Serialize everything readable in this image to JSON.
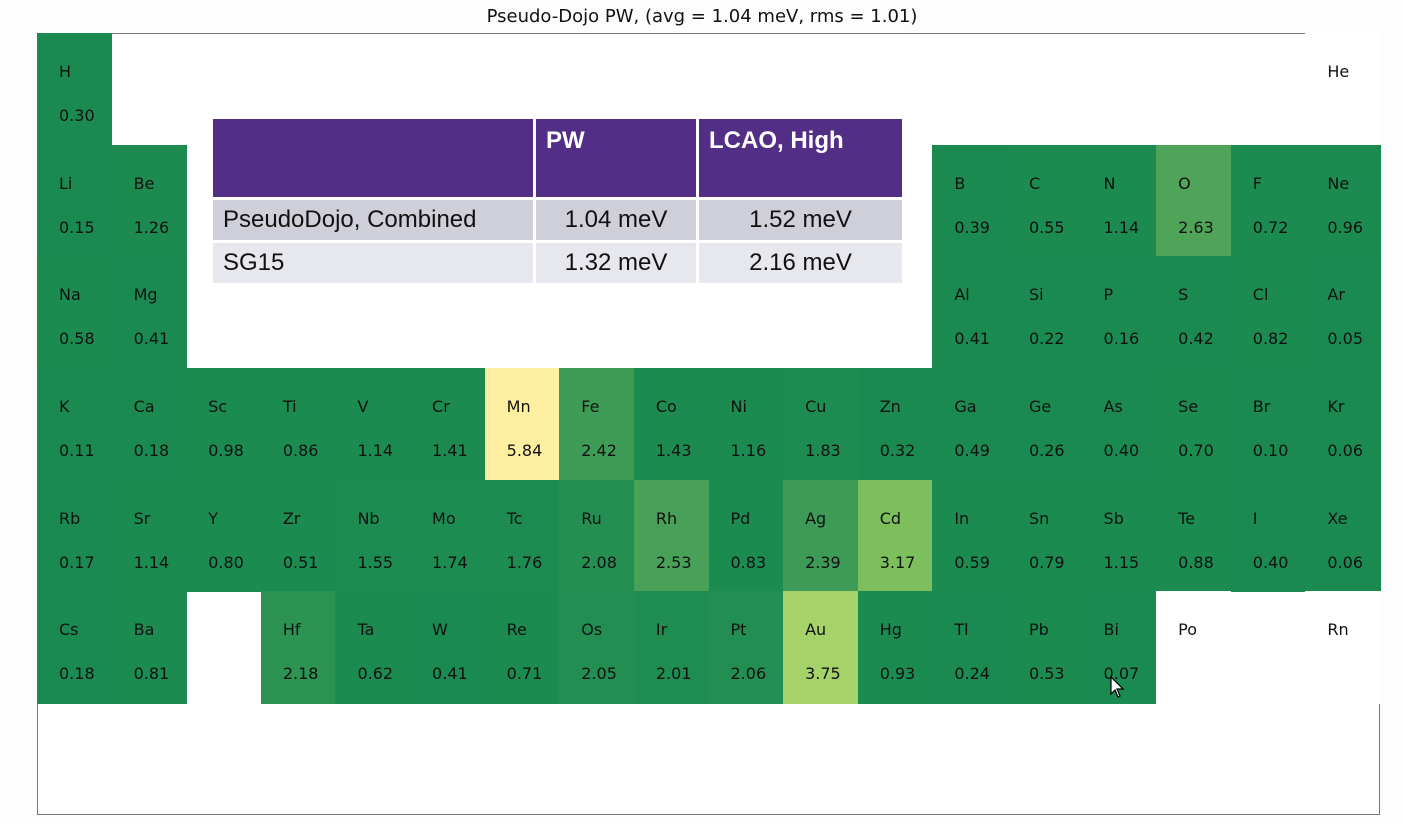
{
  "chart_data": {
    "type": "heatmap",
    "title": "Pseudo-Dojo PW, (avg = 1.04 meV, rms = 1.01)",
    "units": "meV",
    "elements": [
      {
        "s": "H",
        "v": "0.30",
        "period": 1,
        "group": 1
      },
      {
        "s": "He",
        "v": null,
        "period": 1,
        "group": 18
      },
      {
        "s": "Li",
        "v": "0.15",
        "period": 2,
        "group": 1
      },
      {
        "s": "Be",
        "v": "1.26",
        "period": 2,
        "group": 2
      },
      {
        "s": "B",
        "v": "0.39",
        "period": 2,
        "group": 13
      },
      {
        "s": "C",
        "v": "0.55",
        "period": 2,
        "group": 14
      },
      {
        "s": "N",
        "v": "1.14",
        "period": 2,
        "group": 15
      },
      {
        "s": "O",
        "v": "2.63",
        "period": 2,
        "group": 16
      },
      {
        "s": "F",
        "v": "0.72",
        "period": 2,
        "group": 17
      },
      {
        "s": "Ne",
        "v": "0.96",
        "period": 2,
        "group": 18
      },
      {
        "s": "Na",
        "v": "0.58",
        "period": 3,
        "group": 1
      },
      {
        "s": "Mg",
        "v": "0.41",
        "period": 3,
        "group": 2
      },
      {
        "s": "Al",
        "v": "0.41",
        "period": 3,
        "group": 13
      },
      {
        "s": "Si",
        "v": "0.22",
        "period": 3,
        "group": 14
      },
      {
        "s": "P",
        "v": "0.16",
        "period": 3,
        "group": 15
      },
      {
        "s": "S",
        "v": "0.42",
        "period": 3,
        "group": 16
      },
      {
        "s": "Cl",
        "v": "0.82",
        "period": 3,
        "group": 17
      },
      {
        "s": "Ar",
        "v": "0.05",
        "period": 3,
        "group": 18
      },
      {
        "s": "K",
        "v": "0.11",
        "period": 4,
        "group": 1
      },
      {
        "s": "Ca",
        "v": "0.18",
        "period": 4,
        "group": 2
      },
      {
        "s": "Sc",
        "v": "0.98",
        "period": 4,
        "group": 3
      },
      {
        "s": "Ti",
        "v": "0.86",
        "period": 4,
        "group": 4
      },
      {
        "s": "V",
        "v": "1.14",
        "period": 4,
        "group": 5
      },
      {
        "s": "Cr",
        "v": "1.41",
        "period": 4,
        "group": 6
      },
      {
        "s": "Mn",
        "v": "5.84",
        "period": 4,
        "group": 7
      },
      {
        "s": "Fe",
        "v": "2.42",
        "period": 4,
        "group": 8
      },
      {
        "s": "Co",
        "v": "1.43",
        "period": 4,
        "group": 9
      },
      {
        "s": "Ni",
        "v": "1.16",
        "period": 4,
        "group": 10
      },
      {
        "s": "Cu",
        "v": "1.83",
        "period": 4,
        "group": 11
      },
      {
        "s": "Zn",
        "v": "0.32",
        "period": 4,
        "group": 12
      },
      {
        "s": "Ga",
        "v": "0.49",
        "period": 4,
        "group": 13
      },
      {
        "s": "Ge",
        "v": "0.26",
        "period": 4,
        "group": 14
      },
      {
        "s": "As",
        "v": "0.40",
        "period": 4,
        "group": 15
      },
      {
        "s": "Se",
        "v": "0.70",
        "period": 4,
        "group": 16
      },
      {
        "s": "Br",
        "v": "0.10",
        "period": 4,
        "group": 17
      },
      {
        "s": "Kr",
        "v": "0.06",
        "period": 4,
        "group": 18
      },
      {
        "s": "Rb",
        "v": "0.17",
        "period": 5,
        "group": 1
      },
      {
        "s": "Sr",
        "v": "1.14",
        "period": 5,
        "group": 2
      },
      {
        "s": "Y",
        "v": "0.80",
        "period": 5,
        "group": 3
      },
      {
        "s": "Zr",
        "v": "0.51",
        "period": 5,
        "group": 4
      },
      {
        "s": "Nb",
        "v": "1.55",
        "period": 5,
        "group": 5
      },
      {
        "s": "Mo",
        "v": "1.74",
        "period": 5,
        "group": 6
      },
      {
        "s": "Tc",
        "v": "1.76",
        "period": 5,
        "group": 7
      },
      {
        "s": "Ru",
        "v": "2.08",
        "period": 5,
        "group": 8
      },
      {
        "s": "Rh",
        "v": "2.53",
        "period": 5,
        "group": 9
      },
      {
        "s": "Pd",
        "v": "0.83",
        "period": 5,
        "group": 10
      },
      {
        "s": "Ag",
        "v": "2.39",
        "period": 5,
        "group": 11
      },
      {
        "s": "Cd",
        "v": "3.17",
        "period": 5,
        "group": 12
      },
      {
        "s": "In",
        "v": "0.59",
        "period": 5,
        "group": 13
      },
      {
        "s": "Sn",
        "v": "0.79",
        "period": 5,
        "group": 14
      },
      {
        "s": "Sb",
        "v": "1.15",
        "period": 5,
        "group": 15
      },
      {
        "s": "Te",
        "v": "0.88",
        "period": 5,
        "group": 16
      },
      {
        "s": "I",
        "v": "0.40",
        "period": 5,
        "group": 17
      },
      {
        "s": "Xe",
        "v": "0.06",
        "period": 5,
        "group": 18
      },
      {
        "s": "Cs",
        "v": "0.18",
        "period": 6,
        "group": 1
      },
      {
        "s": "Ba",
        "v": "0.81",
        "period": 6,
        "group": 2
      },
      {
        "s": "Hf",
        "v": "2.18",
        "period": 6,
        "group": 4
      },
      {
        "s": "Ta",
        "v": "0.62",
        "period": 6,
        "group": 5
      },
      {
        "s": "W",
        "v": "0.41",
        "period": 6,
        "group": 6
      },
      {
        "s": "Re",
        "v": "0.71",
        "period": 6,
        "group": 7
      },
      {
        "s": "Os",
        "v": "2.05",
        "period": 6,
        "group": 8
      },
      {
        "s": "Ir",
        "v": "2.01",
        "period": 6,
        "group": 9
      },
      {
        "s": "Pt",
        "v": "2.06",
        "period": 6,
        "group": 10
      },
      {
        "s": "Au",
        "v": "3.75",
        "period": 6,
        "group": 11
      },
      {
        "s": "Hg",
        "v": "0.93",
        "period": 6,
        "group": 12
      },
      {
        "s": "Tl",
        "v": "0.24",
        "period": 6,
        "group": 13
      },
      {
        "s": "Pb",
        "v": "0.53",
        "period": 6,
        "group": 14
      },
      {
        "s": "Bi",
        "v": "0.07",
        "period": 6,
        "group": 15
      },
      {
        "s": "Po",
        "v": null,
        "period": 6,
        "group": 16
      },
      {
        "s": "Rn",
        "v": null,
        "period": 6,
        "group": 18
      }
    ],
    "colors": {
      "low": "#1a8a50",
      "mid": "#7fc05c",
      "high": "#fdeea0"
    }
  },
  "overlay_table": {
    "headers": [
      "",
      "PW",
      "LCAO, High"
    ],
    "rows": [
      [
        "PseudoDojo, Combined",
        "1.04 meV",
        "1.52 meV"
      ],
      [
        "SG15",
        "1.32 meV",
        "2.16 meV"
      ]
    ]
  }
}
